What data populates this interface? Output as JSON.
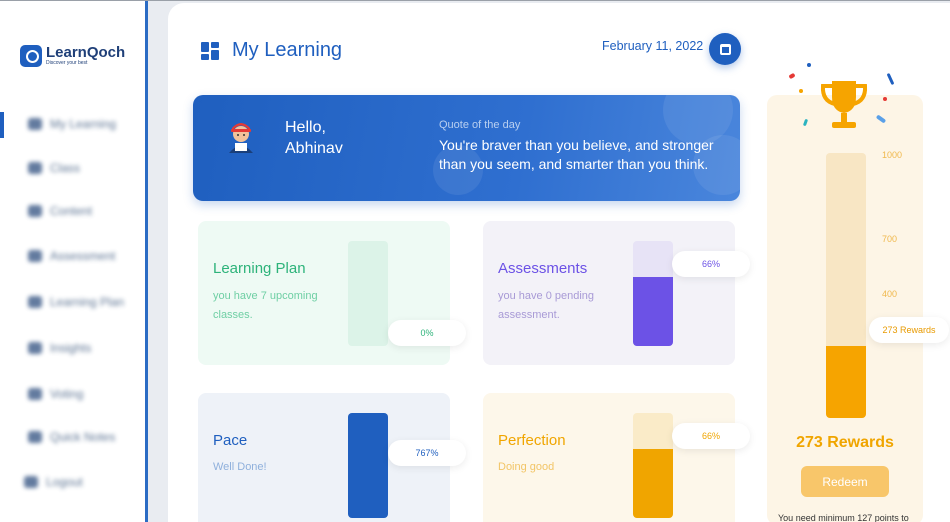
{
  "brand": {
    "name": "LearnQoch",
    "tagline": "Discover your best"
  },
  "sidebar": {
    "items": [
      {
        "label": "My Learning"
      },
      {
        "label": "Class"
      },
      {
        "label": "Content"
      },
      {
        "label": "Assessment"
      },
      {
        "label": "Learning Plan"
      },
      {
        "label": "Insights"
      },
      {
        "label": "Voting"
      },
      {
        "label": "Quick Notes"
      },
      {
        "label": "Logout"
      }
    ]
  },
  "header": {
    "title": "My Learning",
    "date": "February 11, 2022"
  },
  "banner": {
    "greeting_line1": "Hello,",
    "greeting_line2": "Abhinav",
    "quote_label": "Quote of the day",
    "quote": "You're braver than you believe, and stronger than you seem, and smarter than you think."
  },
  "cards": {
    "learning_plan": {
      "title": "Learning Plan",
      "subtitle": "you have 7 upcoming classes.",
      "percent_label": "0%",
      "fill": 0.0,
      "color": "#2db37a"
    },
    "assessments": {
      "title": "Assessments",
      "subtitle": "you have 0 pending assessment.",
      "percent_label": "66%",
      "fill": 0.66,
      "color": "#6c52e6"
    },
    "pace": {
      "title": "Pace",
      "subtitle": "Well Done!",
      "percent_label": "767%",
      "fill": 1.0,
      "color": "#1f5fbf"
    },
    "perfection": {
      "title": "Perfection",
      "subtitle": "Doing good",
      "percent_label": "66%",
      "fill": 0.66,
      "color": "#f0a500"
    }
  },
  "rewards": {
    "ticks": [
      "1000",
      "700",
      "400"
    ],
    "current_label": "273 Rewards",
    "title": "273 Rewards",
    "fill": 0.273,
    "redeem_label": "Redeem",
    "note": "You need minimum 127 points to"
  }
}
